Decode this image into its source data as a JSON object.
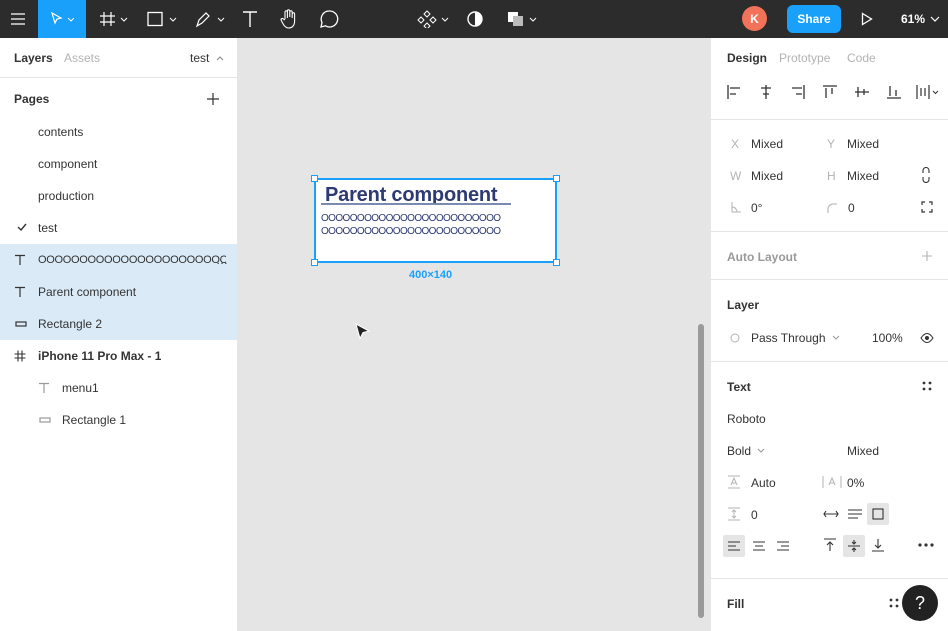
{
  "toolbar": {
    "zoom": "61%",
    "share_label": "Share",
    "avatar_initial": "K",
    "accent": "#18a0fb"
  },
  "left_panel": {
    "tabs": [
      "Layers",
      "Assets"
    ],
    "current_page_selector": "test",
    "pages_header": "Pages",
    "pages": [
      "contents",
      "component",
      "production",
      "test"
    ],
    "current_page": "test",
    "layers": [
      {
        "label": "OOOOOOOOOOOOOOOOOOOOOOOO",
        "icon": "text-icon",
        "selected": true
      },
      {
        "label": "Parent component",
        "icon": "text-icon",
        "selected": true
      },
      {
        "label": "Rectangle 2",
        "icon": "rectangle-icon",
        "selected": true
      },
      {
        "label": "iPhone 11 Pro Max - 1",
        "icon": "frame-icon",
        "selected": false
      },
      {
        "label": "menu1",
        "icon": "text-icon",
        "selected": false
      },
      {
        "label": "Rectangle 1",
        "icon": "rectangle-icon",
        "selected": false
      }
    ]
  },
  "canvas": {
    "frame_title": "Parent component",
    "circle_row_1": "OOOOOOOOOOOOOOOOOOOOOOOOO",
    "circle_row_2": "OOOOOOOOOOOOOOOOOOOOOOOOO",
    "dimensions": "400×140"
  },
  "right_panel": {
    "tabs": [
      "Design",
      "Prototype",
      "Code"
    ],
    "x_label": "X",
    "x_value": "Mixed",
    "y_label": "Y",
    "y_value": "Mixed",
    "w_label": "W",
    "w_value": "Mixed",
    "h_label": "H",
    "h_value": "Mixed",
    "rotation": "0°",
    "radius": "0",
    "auto_layout": "Auto Layout",
    "layer_title": "Layer",
    "blend_mode": "Pass Through",
    "opacity": "100%",
    "text_title": "Text",
    "font_family": "Roboto",
    "font_weight": "Bold",
    "font_size": "Mixed",
    "line_height": "Auto",
    "letter_spacing": "0%",
    "paragraph_spacing": "0",
    "fill_title": "Fill"
  }
}
